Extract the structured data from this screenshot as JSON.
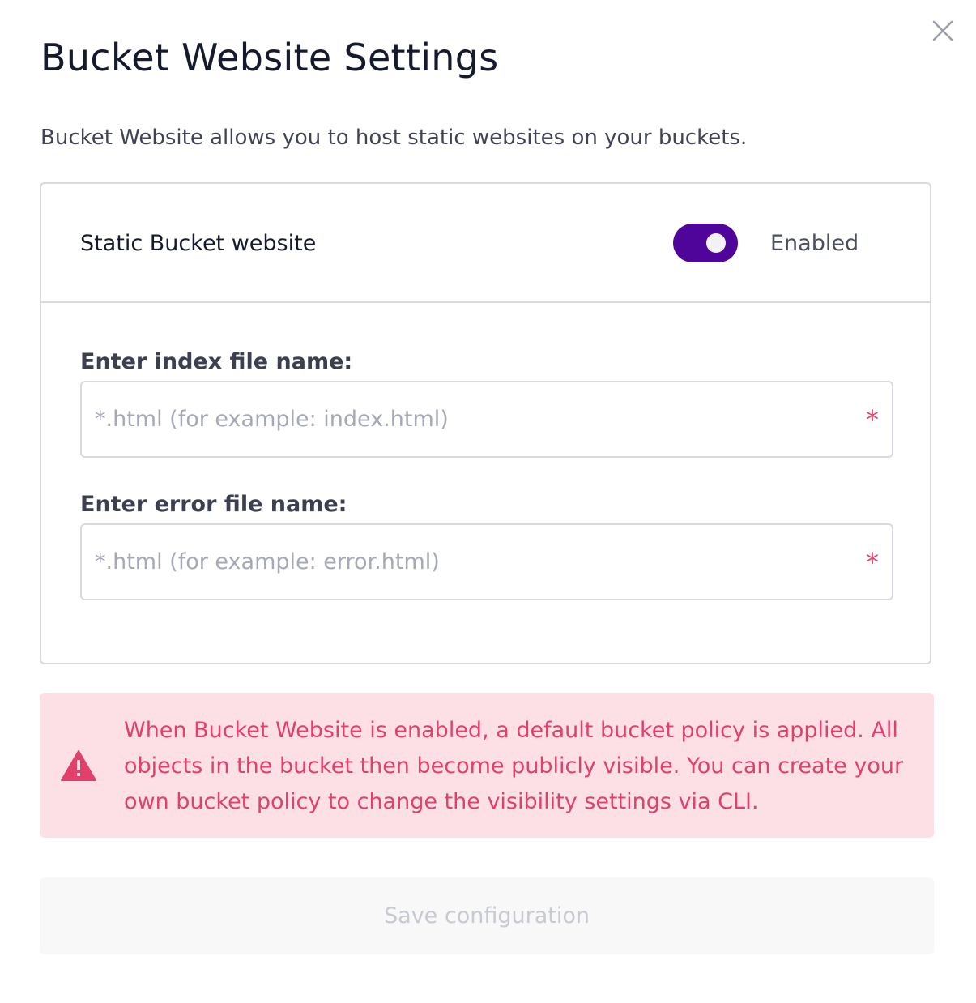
{
  "dialog": {
    "title": "Bucket Website Settings",
    "description": "Bucket Website allows you to host static websites on your buckets.",
    "close_icon": "close-icon"
  },
  "static_website": {
    "label": "Static Bucket website",
    "toggle_state": "Enabled",
    "toggle_on": true,
    "toggle_color": "#4f0599"
  },
  "index_field": {
    "label": "Enter index file name:",
    "value": "",
    "placeholder": "*.html (for example: index.html)",
    "required_mark": "*"
  },
  "error_field": {
    "label": "Enter error file name:",
    "value": "",
    "placeholder": "*.html (for example: error.html)",
    "required_mark": "*"
  },
  "alert": {
    "icon": "warning-triangle-icon",
    "message": "When Bucket Website is enabled, a default bucket policy is applied. All objects in the bucket then become publicly visible. You can create your own bucket policy to change the visibility settings via CLI.",
    "text_color": "#e0406a",
    "background_color": "#fde0e5"
  },
  "actions": {
    "save_label": "Save configuration",
    "save_disabled": true
  }
}
